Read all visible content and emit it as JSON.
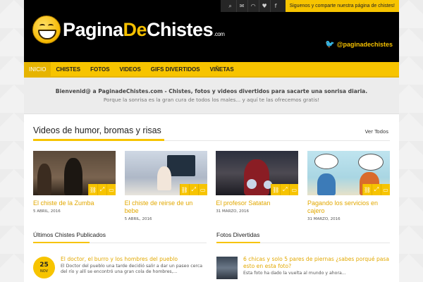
{
  "topbar": {
    "icons": [
      "search-icon",
      "mail-icon",
      "rss-icon",
      "twitter-icon",
      "facebook-icon"
    ],
    "glyphs": [
      "⌕",
      "✉",
      "◠",
      "♥",
      "f"
    ],
    "message": "Siguenos y comparte nuestra página de chistes!"
  },
  "logo": {
    "part1": "Pagina",
    "part2": "De",
    "part3": "Chistes",
    "domain": ".com"
  },
  "twitter": {
    "handle": "@paginadechistes"
  },
  "nav": {
    "items": [
      {
        "label": "INICIO",
        "active": true
      },
      {
        "label": "CHISTES"
      },
      {
        "label": "FOTOS"
      },
      {
        "label": "VIDEOS"
      },
      {
        "label": "GIFS DIVERTIDOS"
      },
      {
        "label": "VIÑETAS"
      }
    ]
  },
  "welcome": {
    "line1": "Bienvenid@ a PaginadeChistes.com - Chistes, fotos y videos divertidos para sacarte una sonrisa diaria.",
    "line2": "Porque la sonrisa es la gran cura de todos los males... y aquí te las ofrecemos gratis!"
  },
  "videos": {
    "title": "Videos de humor, bromas y risas",
    "view_all": "Ver Todos",
    "cards": [
      {
        "title": "El chiste de la Zumba",
        "date": "5 ABRIL, 2016"
      },
      {
        "title": "El chiste de reirse de un bebe",
        "date": "5 ABRIL, 2016"
      },
      {
        "title": "El profesor Satatan",
        "date": "31 MARZO, 2016"
      },
      {
        "title": "Pagando los servicios en cajero",
        "date": "31 MARZO, 2016"
      }
    ]
  },
  "chistes": {
    "title": "Últimos Chistes Publicados",
    "post": {
      "day": "25",
      "month": "NOV",
      "title": "El doctor, el burro y los hombres del pueblo",
      "excerpt": "El Doctor del pueblo una tarde decidió salir a dar un paseo cerca del río y allí se encontró una gran cola de hombres,..."
    }
  },
  "fotos": {
    "title": "Fotos Divertidas",
    "post": {
      "title": "6 chicas y solo 5 pares de piernas ¿sabes porqué pasa esto en esta foto?",
      "excerpt": "Esta foto ha dado la vuelta al mundo y ahora..."
    }
  },
  "colors": {
    "accent": "#f7c400",
    "header_bg": "#000000",
    "link": "#e2a800"
  }
}
